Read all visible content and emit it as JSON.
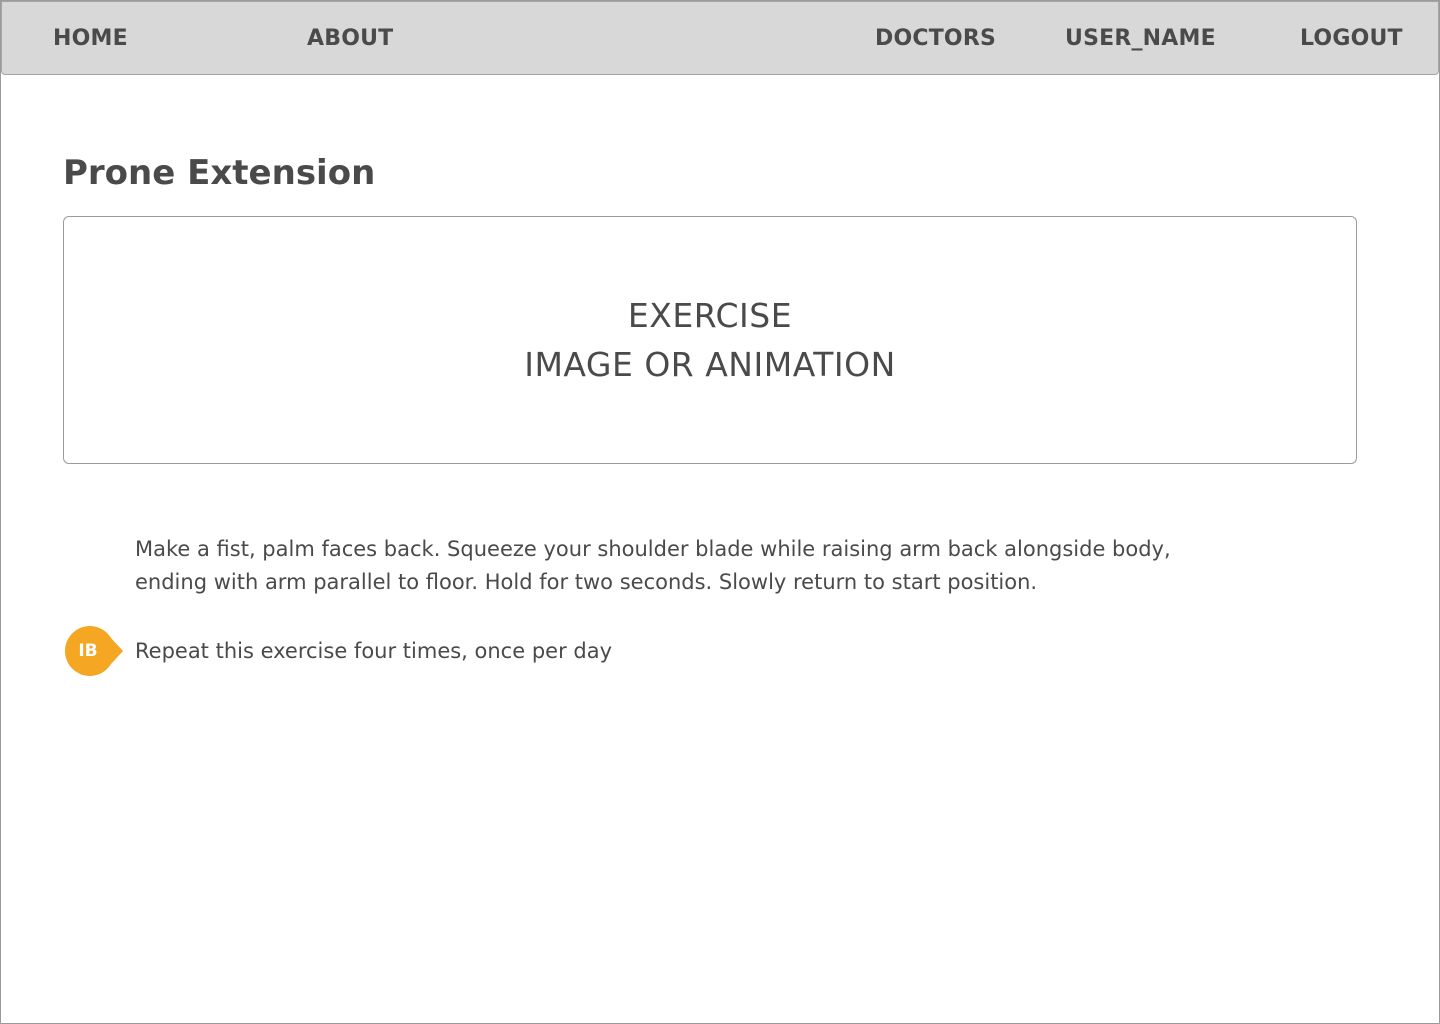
{
  "nav": {
    "home": "HOME",
    "about": "ABOUT",
    "doctors": "DOCTORS",
    "user_name": "USER_NAME",
    "logout": "LOGOUT"
  },
  "page": {
    "title": "Prone Extension"
  },
  "media": {
    "line1": "EXERCISE",
    "line2": "IMAGE OR ANIMATION"
  },
  "instructions": {
    "description": "Make a fist, palm faces back.  Squeeze your shoulder blade while raising arm back alongside body,\nending with arm parallel to floor.  Hold for two seconds.  Slowly return to start position.",
    "repeat": "Repeat this exercise four times, once per day"
  },
  "badge": {
    "initials": "IB",
    "color": "#f5a623"
  },
  "colors": {
    "nav_background": "#d8d8d8",
    "text": "#4a4a4a",
    "border": "#9b9b9b"
  }
}
